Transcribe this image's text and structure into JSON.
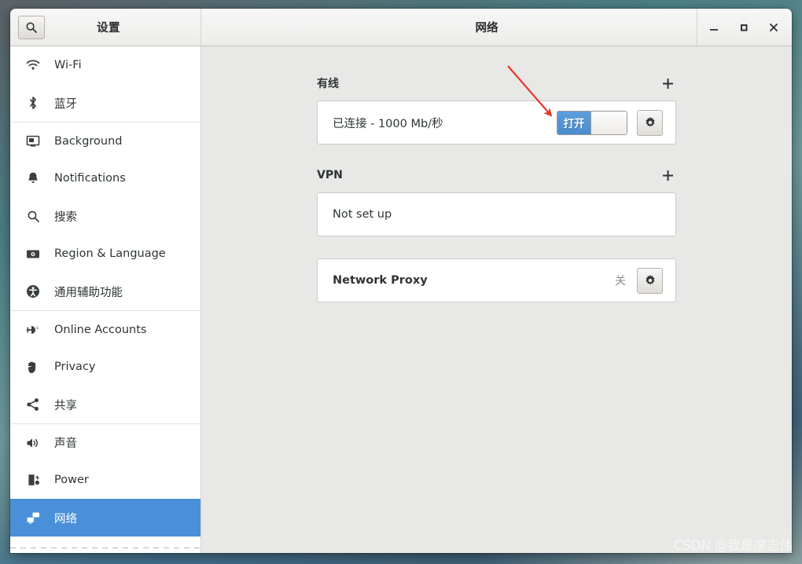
{
  "window": {
    "sidebar_title": "设置",
    "content_title": "网络",
    "search_icon": "search-icon",
    "controls": {
      "minimize": "minimize-icon",
      "maximize": "maximize-icon",
      "close": "close-icon"
    }
  },
  "sidebar": {
    "items": [
      {
        "label": "Wi-Fi",
        "icon": "wifi-icon",
        "active": false,
        "separator_above": false
      },
      {
        "label": "蓝牙",
        "icon": "bluetooth-icon",
        "active": false,
        "separator_above": false
      },
      {
        "label": "Background",
        "icon": "background-icon",
        "active": false,
        "separator_above": true
      },
      {
        "label": "Notifications",
        "icon": "bell-icon",
        "active": false,
        "separator_above": false
      },
      {
        "label": "搜索",
        "icon": "search-icon",
        "active": false,
        "separator_above": false
      },
      {
        "label": "Region & Language",
        "icon": "region-icon",
        "active": false,
        "separator_above": false
      },
      {
        "label": "通用辅助功能",
        "icon": "accessibility-icon",
        "active": false,
        "separator_above": false
      },
      {
        "label": "Online Accounts",
        "icon": "online-accounts-icon",
        "active": false,
        "separator_above": true
      },
      {
        "label": "Privacy",
        "icon": "hand-icon",
        "active": false,
        "separator_above": false
      },
      {
        "label": "共享",
        "icon": "share-icon",
        "active": false,
        "separator_above": false
      },
      {
        "label": "声音",
        "icon": "sound-icon",
        "active": false,
        "separator_above": true
      },
      {
        "label": "Power",
        "icon": "power-icon",
        "active": false,
        "separator_above": false
      },
      {
        "label": "网络",
        "icon": "network-icon",
        "active": true,
        "separator_above": false
      }
    ]
  },
  "content": {
    "wired": {
      "title": "有线",
      "add_label": "+",
      "status": "已连接 - 1000 Mb/秒",
      "switch_label": "打开",
      "settings_icon": "gear-icon"
    },
    "vpn": {
      "title": "VPN",
      "add_label": "+",
      "status": "Not set up"
    },
    "proxy": {
      "label": "Network Proxy",
      "status": "关",
      "settings_icon": "gear-icon"
    }
  },
  "annotation": {
    "arrow_color": "#e8312a"
  },
  "watermark": {
    "text": "CSDN @我是廖志伟"
  },
  "colors": {
    "selection_blue": "#4a90d9",
    "content_bg": "#e8e8e6",
    "card_bg": "#ffffff"
  }
}
